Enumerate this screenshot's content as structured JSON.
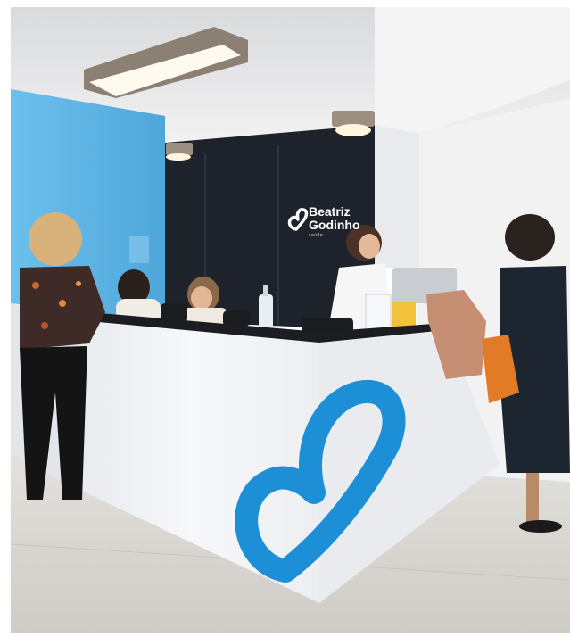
{
  "scene": {
    "description_free": true,
    "brand": {
      "name_line1": "Beatriz",
      "name_line2": "Godinho",
      "sub": "saúde"
    },
    "colors": {
      "wall_blue": "#5fb6e4",
      "ceiling": "#e9eaec",
      "dark_panel": "#1e232b",
      "counter_white": "#f3f4f6",
      "counter_top": "#1b1d22",
      "brand_blue": "#1d8fd6",
      "floor": "#dcdad6"
    },
    "icons": {
      "logo_mark": "heart-logo-icon",
      "counter_logo": "heart-logo-icon"
    }
  }
}
